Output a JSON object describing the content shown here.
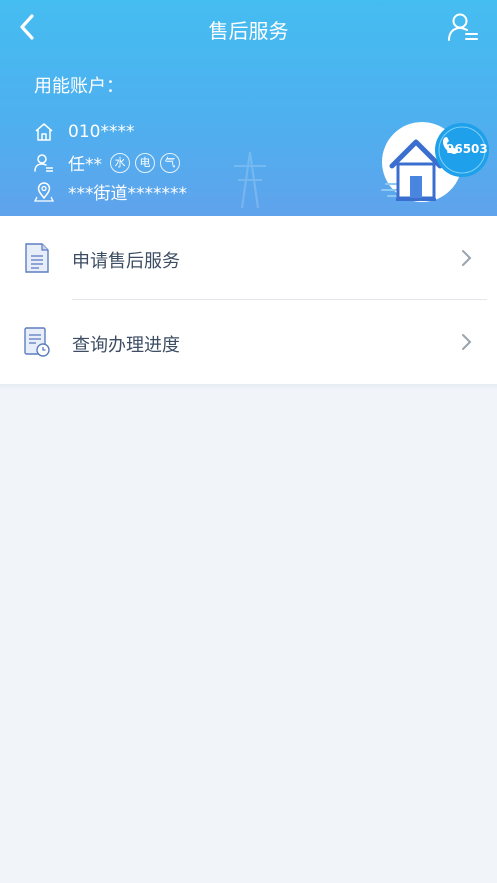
{
  "header": {
    "title": "售后服务",
    "back_icon": "chevron-left-icon",
    "user_icon": "user-list-icon"
  },
  "account": {
    "label": "用能账户：",
    "number": "010****",
    "name": "任**",
    "services": [
      "水",
      "电",
      "气"
    ],
    "address": "***街道*******"
  },
  "hotline": "96503",
  "menu": [
    {
      "label": "申请售后服务",
      "icon": "document-icon"
    },
    {
      "label": "查询办理进度",
      "icon": "document-clock-icon"
    }
  ],
  "colors": {
    "header_top": "#45bdf1",
    "header_bottom": "#5fa3ec",
    "background": "#f1f5fa",
    "text": "#3d4d63"
  }
}
